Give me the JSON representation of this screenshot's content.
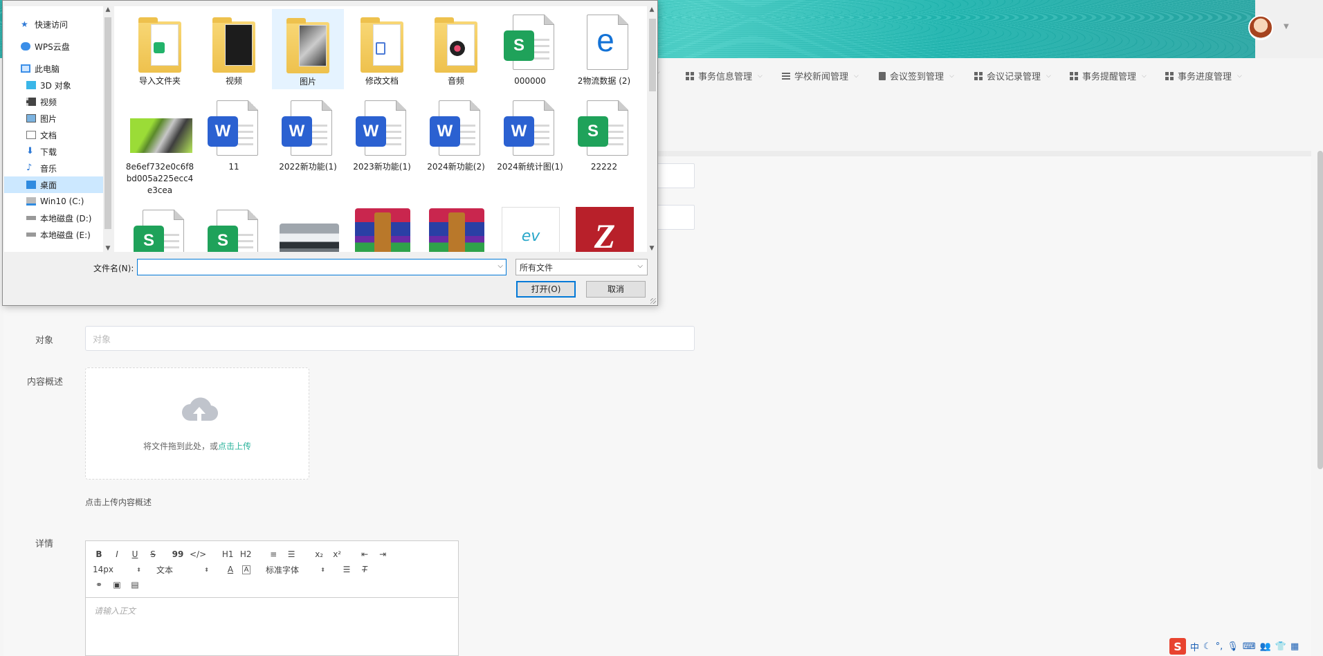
{
  "nav": {
    "items": [
      {
        "label": "事务信息管理",
        "icon": "grid-icon"
      },
      {
        "label": "学校新闻管理",
        "icon": "list-icon"
      },
      {
        "label": "会议签到管理",
        "icon": "clipboard-icon"
      },
      {
        "label": "会议记录管理",
        "icon": "grid-icon"
      },
      {
        "label": "事务提醒管理",
        "icon": "grid-icon"
      },
      {
        "label": "事务进度管理",
        "icon": "grid-icon"
      }
    ]
  },
  "form": {
    "object_label": "对象",
    "object_placeholder": "对象",
    "content_label": "内容概述",
    "upload_text": "将文件拖到此处，或",
    "upload_link": "点击上传",
    "upload_hint": "点击上传内容概述",
    "detail_label": "详情"
  },
  "editor": {
    "buttons_row1": [
      "B",
      "I",
      "U",
      "S",
      "99",
      "</>",
      "H1",
      "H2",
      "≡",
      "☰",
      "x₂",
      "x²",
      "⇤",
      "⇥"
    ],
    "font_size": "14px",
    "format": "文本",
    "font_family": "标准字体",
    "placeholder": "请输入正文"
  },
  "dialog": {
    "tree": [
      {
        "label": "快速访问",
        "icon": "star-icon"
      },
      {
        "label": "WPS云盘",
        "icon": "cloud-icon"
      },
      {
        "label": "此电脑",
        "icon": "computer-icon"
      },
      {
        "label": "3D 对象",
        "icon": "cube-icon"
      },
      {
        "label": "视频",
        "icon": "video-icon"
      },
      {
        "label": "图片",
        "icon": "picture-icon"
      },
      {
        "label": "文档",
        "icon": "document-icon"
      },
      {
        "label": "下载",
        "icon": "download-icon"
      },
      {
        "label": "音乐",
        "icon": "music-icon"
      },
      {
        "label": "桌面",
        "icon": "desktop-icon",
        "selected": true
      },
      {
        "label": "Win10 (C:)",
        "icon": "drive-icon"
      },
      {
        "label": "本地磁盘 (D:)",
        "icon": "drive-icon"
      },
      {
        "label": "本地磁盘 (E:)",
        "icon": "drive-icon"
      }
    ],
    "files": [
      {
        "name": "导入文件夹",
        "kind": "folder"
      },
      {
        "name": "视频",
        "kind": "folder"
      },
      {
        "name": "图片",
        "kind": "folder"
      },
      {
        "name": "修改文档",
        "kind": "folder"
      },
      {
        "name": "音频",
        "kind": "folder"
      },
      {
        "name": "000000",
        "kind": "spreadsheet"
      },
      {
        "name": "2物流数据 (2)",
        "kind": "edge-html"
      },
      {
        "name": "8e6ef732e0c6f8bd005a225ecc4e3cea",
        "kind": "image"
      },
      {
        "name": "11",
        "kind": "word"
      },
      {
        "name": "2022新功能(1)",
        "kind": "word"
      },
      {
        "name": "2023新功能(1)",
        "kind": "word"
      },
      {
        "name": "2024新功能(2)",
        "kind": "word"
      },
      {
        "name": "2024新统计图(1)",
        "kind": "word"
      },
      {
        "name": "22222",
        "kind": "spreadsheet"
      }
    ],
    "file_name_label": "文件名(N):",
    "file_name_value": "",
    "file_type": "所有文件",
    "open_button": "打开(O)",
    "cancel_button": "取消"
  },
  "tray": {
    "ime": "中"
  }
}
